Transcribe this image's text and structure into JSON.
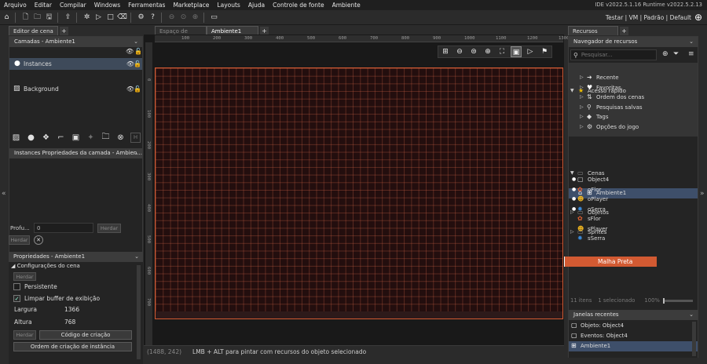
{
  "menu": [
    "Arquivo",
    "Editar",
    "Compilar",
    "Windows",
    "Ferramentas",
    "Marketplace",
    "Layouts",
    "Ajuda",
    "Controle de fonte",
    "Ambiente"
  ],
  "ide_version": "IDE v2022.5.1.16  Runtime v2022.5.2.13",
  "user_info": "Testar | VM | Padrão | Default",
  "left": {
    "tab": "Editor de cena",
    "layers_header": "Camadas - Ambiente1",
    "layers": [
      {
        "label": "Instances",
        "selected": true
      },
      {
        "label": "Background",
        "selected": false
      }
    ],
    "layer_props_header": "Instances Propriedades da camada - Ambien...",
    "depth_label": "Profu...",
    "depth_value": "0",
    "inherit": "Herdar",
    "props_header": "Propriedades - Ambiente1",
    "room_settings": "Configurações do cena",
    "persistent": "Persistente",
    "clear_buffer": "Limpar buffer de exibição",
    "width_label": "Largura",
    "width_value": "1366",
    "height_label": "Altura",
    "height_value": "768",
    "creation_code": "Código de criação",
    "instance_order": "Ordem de criação de instância"
  },
  "center": {
    "tabs": [
      {
        "label": "Espaço de tra...",
        "active": false
      },
      {
        "label": "Ambiente1",
        "active": true
      }
    ],
    "ruler_h": [
      "100",
      "200",
      "300",
      "400",
      "500",
      "600",
      "700",
      "800",
      "900",
      "1000",
      "1100",
      "1200",
      "1300"
    ],
    "ruler_v": [
      "0",
      "100",
      "200",
      "300",
      "400",
      "500",
      "600",
      "700"
    ],
    "coords": "(1488, 242)",
    "status": "LMB + ALT para pintar com recursos do objeto selecionado"
  },
  "right": {
    "tab": "Recursos",
    "browser_header": "Navegador de recursos",
    "search_placeholder": "Pesquisar...",
    "quick_access": "Acesso rápido",
    "quick_items": [
      "Recente",
      "Favoritas",
      "Ordem dos cenas",
      "Pesquisas salvas",
      "Tags",
      "Opções do jogo"
    ],
    "scenes": "Cenas",
    "scene_item": "Ambiente1",
    "folders": [
      "Objetos",
      "Sprites"
    ],
    "assets": [
      {
        "label": "Object4",
        "icon": "object-box-icon",
        "color": "#dddddd"
      },
      {
        "label": "oFlor",
        "icon": "flower-icon",
        "color": "#e06030"
      },
      {
        "label": "oPlayer",
        "icon": "player-icon",
        "color": "#e8b020"
      },
      {
        "label": "oSerra",
        "icon": "saw-icon",
        "color": "#3a8ad8"
      },
      {
        "label": "sFlor",
        "icon": "flower-icon",
        "color": "#e06030"
      },
      {
        "label": "sPlayer",
        "icon": "player-icon",
        "color": "#e8b020"
      },
      {
        "label": "sSerra",
        "icon": "saw-icon",
        "color": "#3a8ad8"
      }
    ],
    "tag_label": "Malha Preta",
    "item_count": "11 itens",
    "selected_count": "1 selecionado",
    "zoom": "100%",
    "recent_header": "Janelas recentes",
    "recent": [
      "Objeto: Object4",
      "Eventos: Object4",
      "Ambiente1"
    ]
  },
  "colors": {
    "accent_orange": "#d25a32",
    "selection_blue": "#3e4f6a"
  }
}
